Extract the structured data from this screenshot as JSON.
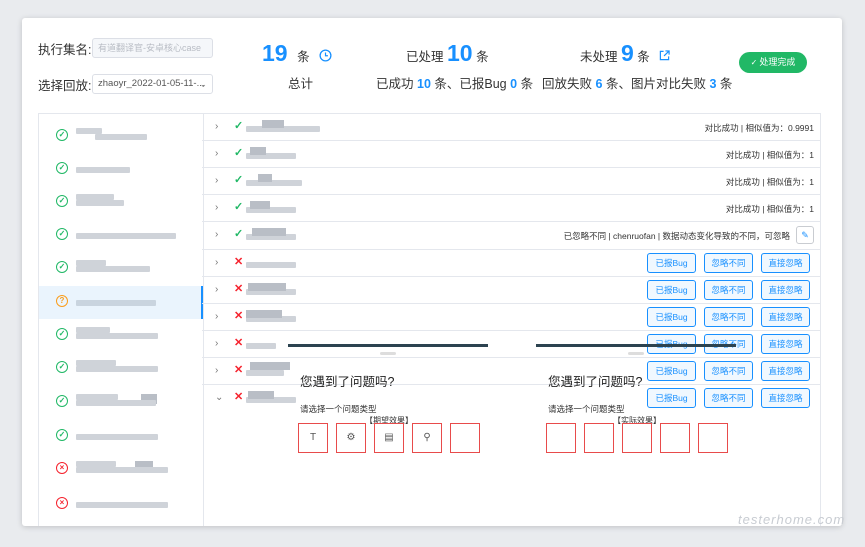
{
  "filters": {
    "set_label": "执行集名:",
    "set_placeholder": "有道翻译官-安卓核心case",
    "replay_label": "选择回放:",
    "replay_value": "zhaoyr_2022-01-05-11-..."
  },
  "stats": {
    "total_value": "19",
    "total_unit": "条",
    "total_label": "总计",
    "processed_prefix": "已处理",
    "processed_value": "10",
    "processed_unit": "条",
    "processed_detail": {
      "a": "已成功",
      "success": "10",
      "b": "条、已报Bug",
      "bug": "0",
      "c": "条"
    },
    "unprocessed_prefix": "未处理",
    "unprocessed_value": "9",
    "unprocessed_unit": "条",
    "unprocessed_detail": {
      "a": "回放失败",
      "replay_fail": "6",
      "b": "条、图片对比失败",
      "img_fail": "3",
      "c": "条"
    }
  },
  "done_button": "处理完成",
  "sidebar": {
    "items": [
      {
        "status": "ok"
      },
      {
        "status": "ok"
      },
      {
        "status": "ok"
      },
      {
        "status": "ok"
      },
      {
        "status": "ok"
      },
      {
        "status": "warn",
        "active": true
      },
      {
        "status": "ok"
      },
      {
        "status": "ok"
      },
      {
        "status": "ok"
      },
      {
        "status": "ok"
      },
      {
        "status": "fail"
      },
      {
        "status": "fail"
      }
    ]
  },
  "rows": [
    {
      "status": "ok",
      "arrow": "›",
      "result": "对比成功 | 相似值为：0.9991"
    },
    {
      "status": "ok",
      "arrow": "›",
      "result": "对比成功 | 相似值为：1"
    },
    {
      "status": "ok",
      "arrow": "›",
      "result": "对比成功 | 相似值为：1"
    },
    {
      "status": "ok",
      "arrow": "›",
      "result": "对比成功 | 相似值为：1"
    },
    {
      "status": "ok",
      "arrow": "›",
      "result": "已忽略不同 | chenruofan | 数据动态变化导致的不同，可忽略",
      "editable": true
    },
    {
      "status": "fail",
      "arrow": "›"
    },
    {
      "status": "fail",
      "arrow": "›"
    },
    {
      "status": "fail",
      "arrow": "›"
    },
    {
      "status": "fail",
      "arrow": "›"
    },
    {
      "status": "fail",
      "arrow": "›"
    },
    {
      "status": "fail",
      "arrow": "⌄",
      "expanded": true
    }
  ],
  "row_actions": {
    "report_bug": "已报Bug",
    "ignore_diff": "忽略不同",
    "ignore_direct": "直接忽略"
  },
  "preview": {
    "expected_label": "【期望效果】",
    "actual_label": "【实际效果】",
    "title": "您遇到了问题吗?",
    "subtitle": "请选择一个问题类型"
  },
  "watermark": "testerhome.com",
  "colors": {
    "accent": "#1890ff",
    "success": "#21b866",
    "error": "#f5222d",
    "warning": "#fa9d1c"
  },
  "icons": {
    "success": "check-circle-icon",
    "fail": "close-circle-icon",
    "warn": "question-circle-icon",
    "total": "clock-icon",
    "unprocessed": "external-link-icon",
    "edit": "edit-icon"
  }
}
